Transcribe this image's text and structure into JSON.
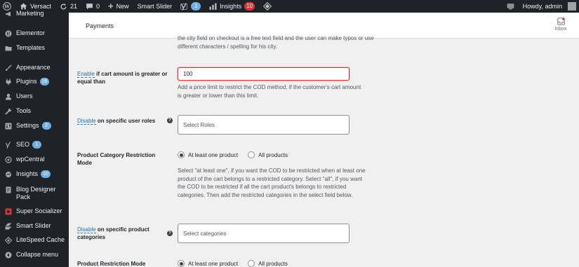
{
  "adminbar": {
    "site_name": "Versact",
    "updates_count": "21",
    "comments_count": "0",
    "new_label": "New",
    "smart_slider_label": "Smart Slider",
    "yoast_count": "1",
    "insights_label": "Insights",
    "insights_count": "10",
    "howdy": "Howdy, admin"
  },
  "sidebar": {
    "items": [
      {
        "label": "Marketing"
      },
      {
        "label": "Elementor"
      },
      {
        "label": "Templates"
      },
      {
        "label": "Appearance"
      },
      {
        "label": "Plugins",
        "badge": "16"
      },
      {
        "label": "Users"
      },
      {
        "label": "Tools"
      },
      {
        "label": "Settings",
        "badge": "2"
      },
      {
        "label": "SEO",
        "badge": "1"
      },
      {
        "label": "wpCentral"
      },
      {
        "label": "Insights",
        "badge": "10"
      },
      {
        "label": "Blog Designer Pack"
      },
      {
        "label": "Super Socializer"
      },
      {
        "label": "Smart Slider"
      },
      {
        "label": "LiteSpeed Cache"
      },
      {
        "label": "Collapse menu"
      }
    ]
  },
  "header": {
    "title": "Payments",
    "inbox_label": "Inbox"
  },
  "form": {
    "city_desc": "the city field on checkout is a free text field and the user can make typos or use different characters / spelling for his city.",
    "cart_amount": {
      "link": "Enable",
      "label_rest": " if cart amount is greater or equal than",
      "value": "100",
      "desc": "Add a price limit to restrict the COD method, if the customer's cart amount is greater or lower than this limit."
    },
    "user_roles": {
      "link": "Disable",
      "label_rest": " on specific user roles",
      "placeholder": "Select Roles"
    },
    "category_mode": {
      "label": "Product Category Restriction Mode",
      "option_1": "At least one product",
      "option_2": "All products",
      "desc": "Select \"at least one\", if you want the COD to be restricted when at least one product of the cart belongs to a restricted category. Select \"all\", if you want the COD to be restricted if all the cart product's belongs to restricted categories. Then add the restricted categories in the select field below."
    },
    "product_categories": {
      "link": "Disable",
      "label_rest": " on specific product categories",
      "placeholder": "Select categories"
    },
    "product_mode": {
      "label": "Product Restriction Mode",
      "option_1": "At least one product",
      "option_2": "All products"
    }
  }
}
